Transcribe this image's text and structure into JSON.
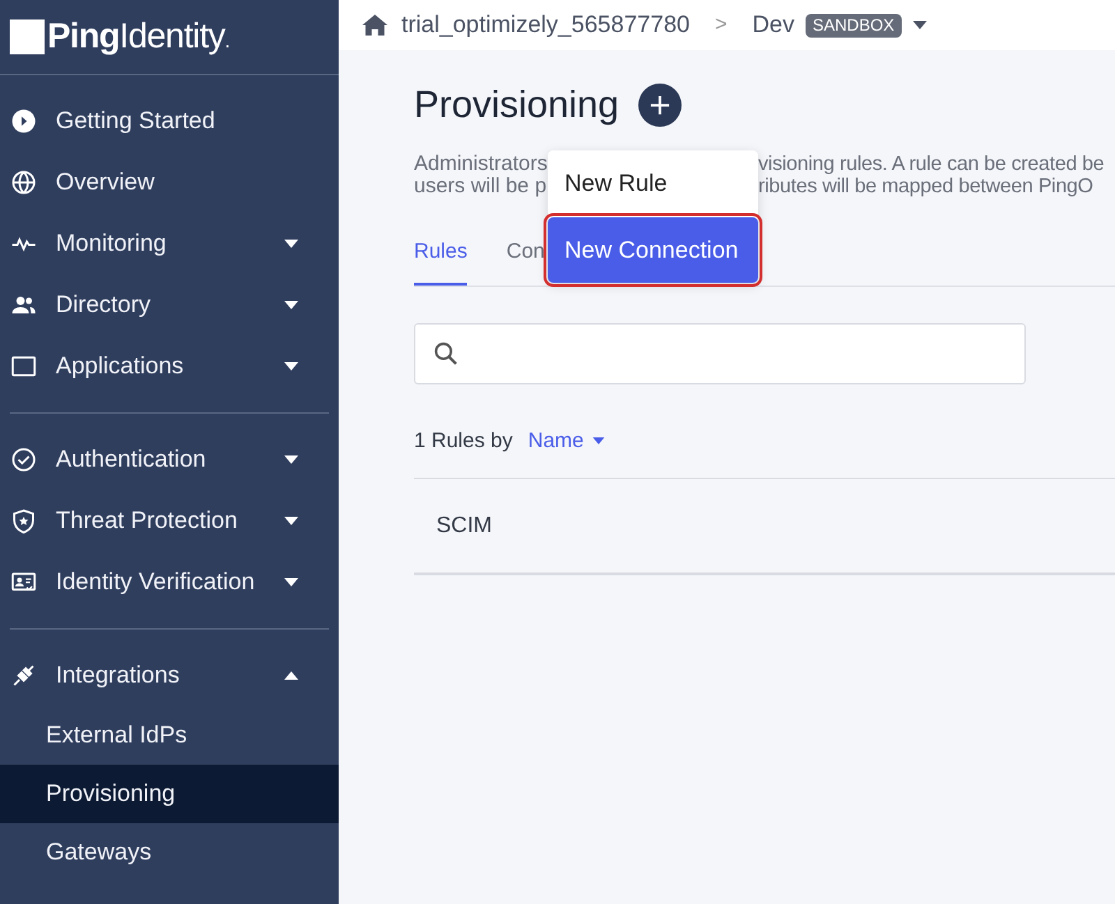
{
  "logo": {
    "text_bold": "Ping",
    "text_light": "Identity",
    "mark": "."
  },
  "sidebar": {
    "groups": [
      {
        "items": [
          {
            "label": "Getting Started"
          },
          {
            "label": "Overview"
          },
          {
            "label": "Monitoring",
            "expanded": false
          },
          {
            "label": "Directory",
            "expanded": false
          },
          {
            "label": "Applications",
            "expanded": false
          }
        ]
      },
      {
        "items": [
          {
            "label": "Authentication",
            "expanded": false
          },
          {
            "label": "Threat Protection",
            "expanded": false
          },
          {
            "label": "Identity Verification",
            "expanded": false
          }
        ]
      },
      {
        "items": [
          {
            "label": "Integrations",
            "expanded": true,
            "children": [
              {
                "label": "External IdPs",
                "selected": false
              },
              {
                "label": "Provisioning",
                "selected": true
              },
              {
                "label": "Gateways",
                "selected": false
              }
            ]
          }
        ]
      }
    ]
  },
  "breadcrumb": {
    "organization": "trial_optimizely_565877780",
    "separator": ">",
    "environment": "Dev",
    "badge": "SANDBOX"
  },
  "page": {
    "title": "Provisioning",
    "description_lines": [
      {
        "left": "Administrators",
        "right": "visioning rules. A rule can be created be"
      },
      {
        "left": "users will be p",
        "right": "ributes will be mapped between PingO"
      }
    ],
    "add_menu": [
      {
        "label": "New Rule",
        "selected": false
      },
      {
        "label": "New Connection",
        "selected": true
      }
    ],
    "tabs": [
      {
        "label": "Rules",
        "selected": true
      },
      {
        "label": "Con",
        "selected": false
      }
    ],
    "summary": "1 Rules by",
    "sort": "Name",
    "rows": [
      {
        "name": "SCIM"
      }
    ]
  }
}
